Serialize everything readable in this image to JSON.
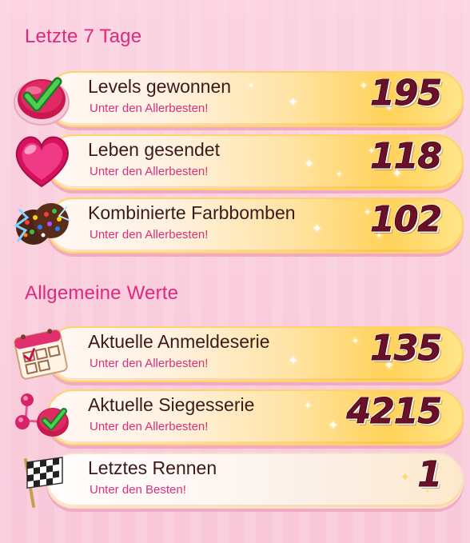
{
  "sections": [
    {
      "title": "Letzte 7 Tage",
      "rows": [
        {
          "icon": "checkmark-candy-icon",
          "label": "Levels gewonnen",
          "sublabel": "Unter den Allerbesten!",
          "value": "195"
        },
        {
          "icon": "heart-icon",
          "label": "Leben gesendet",
          "sublabel": "Unter den Allerbesten!",
          "value": "118"
        },
        {
          "icon": "color-bomb-icon",
          "label": "Kombinierte Farbbomben",
          "sublabel": "Unter den Allerbesten!",
          "value": "102"
        }
      ]
    },
    {
      "title": "Allgemeine Werte",
      "rows": [
        {
          "icon": "calendar-icon",
          "label": "Aktuelle Anmeldeserie",
          "sublabel": "Unter den Allerbesten!",
          "value": "135"
        },
        {
          "icon": "win-streak-icon",
          "label": "Aktuelle Siegesserie",
          "sublabel": "Unter den Allerbesten!",
          "value": "4215"
        },
        {
          "icon": "checkered-flag-icon",
          "label": "Letztes Rennen",
          "sublabel": "Unter den Besten!",
          "value": "1"
        }
      ]
    }
  ],
  "colors": {
    "section_title": "#e0287c",
    "sublabel": "#d8307b",
    "value": "#6a1028",
    "bar_gold": "#ffd25a"
  }
}
